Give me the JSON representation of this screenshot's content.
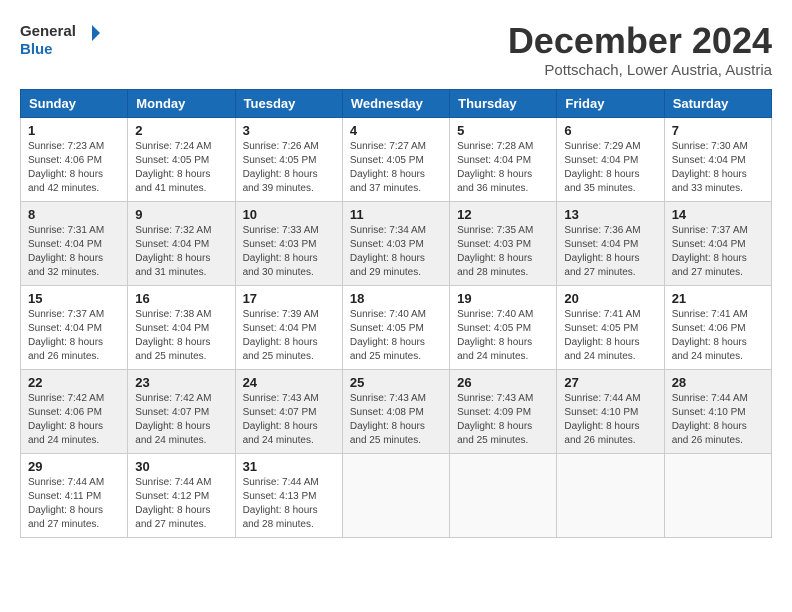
{
  "header": {
    "logo_general": "General",
    "logo_blue": "Blue",
    "month_title": "December 2024",
    "location": "Pottschach, Lower Austria, Austria"
  },
  "days_of_week": [
    "Sunday",
    "Monday",
    "Tuesday",
    "Wednesday",
    "Thursday",
    "Friday",
    "Saturday"
  ],
  "weeks": [
    [
      {
        "day": "1",
        "sunrise": "7:23 AM",
        "sunset": "4:06 PM",
        "daylight": "8 hours and 42 minutes."
      },
      {
        "day": "2",
        "sunrise": "7:24 AM",
        "sunset": "4:05 PM",
        "daylight": "8 hours and 41 minutes."
      },
      {
        "day": "3",
        "sunrise": "7:26 AM",
        "sunset": "4:05 PM",
        "daylight": "8 hours and 39 minutes."
      },
      {
        "day": "4",
        "sunrise": "7:27 AM",
        "sunset": "4:05 PM",
        "daylight": "8 hours and 37 minutes."
      },
      {
        "day": "5",
        "sunrise": "7:28 AM",
        "sunset": "4:04 PM",
        "daylight": "8 hours and 36 minutes."
      },
      {
        "day": "6",
        "sunrise": "7:29 AM",
        "sunset": "4:04 PM",
        "daylight": "8 hours and 35 minutes."
      },
      {
        "day": "7",
        "sunrise": "7:30 AM",
        "sunset": "4:04 PM",
        "daylight": "8 hours and 33 minutes."
      }
    ],
    [
      {
        "day": "8",
        "sunrise": "7:31 AM",
        "sunset": "4:04 PM",
        "daylight": "8 hours and 32 minutes."
      },
      {
        "day": "9",
        "sunrise": "7:32 AM",
        "sunset": "4:04 PM",
        "daylight": "8 hours and 31 minutes."
      },
      {
        "day": "10",
        "sunrise": "7:33 AM",
        "sunset": "4:03 PM",
        "daylight": "8 hours and 30 minutes."
      },
      {
        "day": "11",
        "sunrise": "7:34 AM",
        "sunset": "4:03 PM",
        "daylight": "8 hours and 29 minutes."
      },
      {
        "day": "12",
        "sunrise": "7:35 AM",
        "sunset": "4:03 PM",
        "daylight": "8 hours and 28 minutes."
      },
      {
        "day": "13",
        "sunrise": "7:36 AM",
        "sunset": "4:04 PM",
        "daylight": "8 hours and 27 minutes."
      },
      {
        "day": "14",
        "sunrise": "7:37 AM",
        "sunset": "4:04 PM",
        "daylight": "8 hours and 27 minutes."
      }
    ],
    [
      {
        "day": "15",
        "sunrise": "7:37 AM",
        "sunset": "4:04 PM",
        "daylight": "8 hours and 26 minutes."
      },
      {
        "day": "16",
        "sunrise": "7:38 AM",
        "sunset": "4:04 PM",
        "daylight": "8 hours and 25 minutes."
      },
      {
        "day": "17",
        "sunrise": "7:39 AM",
        "sunset": "4:04 PM",
        "daylight": "8 hours and 25 minutes."
      },
      {
        "day": "18",
        "sunrise": "7:40 AM",
        "sunset": "4:05 PM",
        "daylight": "8 hours and 25 minutes."
      },
      {
        "day": "19",
        "sunrise": "7:40 AM",
        "sunset": "4:05 PM",
        "daylight": "8 hours and 24 minutes."
      },
      {
        "day": "20",
        "sunrise": "7:41 AM",
        "sunset": "4:05 PM",
        "daylight": "8 hours and 24 minutes."
      },
      {
        "day": "21",
        "sunrise": "7:41 AM",
        "sunset": "4:06 PM",
        "daylight": "8 hours and 24 minutes."
      }
    ],
    [
      {
        "day": "22",
        "sunrise": "7:42 AM",
        "sunset": "4:06 PM",
        "daylight": "8 hours and 24 minutes."
      },
      {
        "day": "23",
        "sunrise": "7:42 AM",
        "sunset": "4:07 PM",
        "daylight": "8 hours and 24 minutes."
      },
      {
        "day": "24",
        "sunrise": "7:43 AM",
        "sunset": "4:07 PM",
        "daylight": "8 hours and 24 minutes."
      },
      {
        "day": "25",
        "sunrise": "7:43 AM",
        "sunset": "4:08 PM",
        "daylight": "8 hours and 25 minutes."
      },
      {
        "day": "26",
        "sunrise": "7:43 AM",
        "sunset": "4:09 PM",
        "daylight": "8 hours and 25 minutes."
      },
      {
        "day": "27",
        "sunrise": "7:44 AM",
        "sunset": "4:10 PM",
        "daylight": "8 hours and 26 minutes."
      },
      {
        "day": "28",
        "sunrise": "7:44 AM",
        "sunset": "4:10 PM",
        "daylight": "8 hours and 26 minutes."
      }
    ],
    [
      {
        "day": "29",
        "sunrise": "7:44 AM",
        "sunset": "4:11 PM",
        "daylight": "8 hours and 27 minutes."
      },
      {
        "day": "30",
        "sunrise": "7:44 AM",
        "sunset": "4:12 PM",
        "daylight": "8 hours and 27 minutes."
      },
      {
        "day": "31",
        "sunrise": "7:44 AM",
        "sunset": "4:13 PM",
        "daylight": "8 hours and 28 minutes."
      },
      null,
      null,
      null,
      null
    ]
  ],
  "labels": {
    "sunrise": "Sunrise:",
    "sunset": "Sunset:",
    "daylight": "Daylight:"
  }
}
